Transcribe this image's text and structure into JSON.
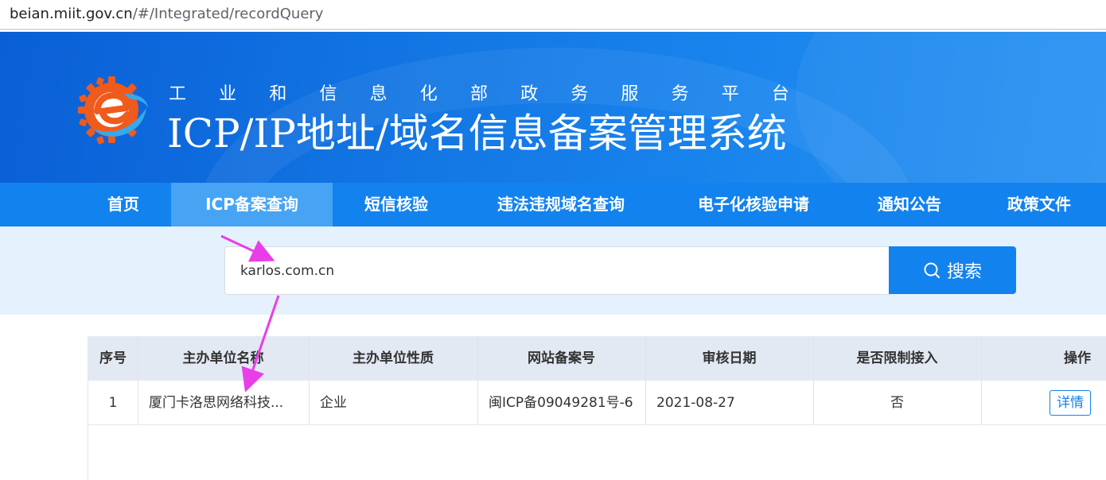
{
  "browser": {
    "url_host": "beian.miit.gov.cn",
    "url_path": "/#/Integrated/recordQuery"
  },
  "header": {
    "subtitle_chars": [
      "工",
      "业",
      "和",
      "信",
      "息",
      "化",
      "部",
      "政",
      "务",
      "服",
      "务",
      "平",
      "台"
    ],
    "title": "ICP/IP地址/域名信息备案管理系统"
  },
  "nav": {
    "items": [
      {
        "label": "首页"
      },
      {
        "label": "ICP备案查询"
      },
      {
        "label": "短信核验"
      },
      {
        "label": "违法违规域名查询"
      },
      {
        "label": "电子化核验申请"
      },
      {
        "label": "通知公告"
      },
      {
        "label": "政策文件"
      }
    ],
    "active_index": 1
  },
  "search": {
    "value": "karlos.com.cn",
    "button_label": "搜索",
    "button_icon": "search-icon"
  },
  "table": {
    "headers": [
      "序号",
      "主办单位名称",
      "主办单位性质",
      "网站备案号",
      "审核日期",
      "是否限制接入",
      "操作"
    ],
    "rows": [
      {
        "index": "1",
        "org_name": "厦门卡洛思网络科技...",
        "org_type": "企业",
        "record_no": "闽ICP备09049281号-6",
        "review_date": "2021-08-27",
        "restricted": "否",
        "action_label": "详情"
      }
    ]
  },
  "colors": {
    "primary": "#1282ee",
    "nav_active": "#47a4f5",
    "search_band": "#e5f1fc",
    "table_header": "#e3e9f3",
    "annotation_arrow": "#e83ee8"
  }
}
